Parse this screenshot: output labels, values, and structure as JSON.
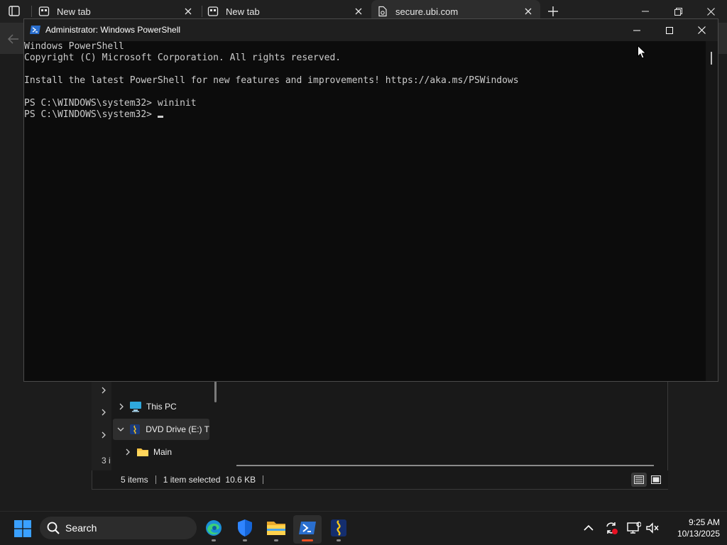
{
  "browser": {
    "tabs": [
      {
        "title": "New tab"
      },
      {
        "title": "New tab"
      },
      {
        "title": "secure.ubi.com"
      }
    ]
  },
  "explorer": {
    "nav_items": [
      {
        "label": "This PC"
      },
      {
        "label": "DVD Drive (E:) T"
      },
      {
        "label": "Main"
      }
    ],
    "left_count_partial": "3 i",
    "status": {
      "items": "5 items",
      "selected": "1 item selected",
      "size": "10.6 KB"
    }
  },
  "powershell": {
    "title": "Administrator: Windows PowerShell",
    "lines": [
      "Windows PowerShell",
      "Copyright (C) Microsoft Corporation. All rights reserved.",
      "",
      "Install the latest PowerShell for new features and improvements! https://aka.ms/PSWindows",
      "",
      "PS C:\\WINDOWS\\system32> wininit",
      "PS C:\\WINDOWS\\system32> "
    ]
  },
  "taskbar": {
    "search_label": "Search",
    "apps": [
      {
        "name": "edge-icon",
        "active": false
      },
      {
        "name": "defender-icon",
        "active": false
      },
      {
        "name": "file-explorer-icon",
        "active": false
      },
      {
        "name": "powershell-icon",
        "active": true
      },
      {
        "name": "installer-app-icon",
        "active": false
      }
    ],
    "time": "9:25 AM",
    "date": "10/13/2025"
  },
  "colors": {
    "accent_active_indicator": "#f25022",
    "console_bg": "#0c0c0c",
    "console_text": "#cccccc"
  }
}
